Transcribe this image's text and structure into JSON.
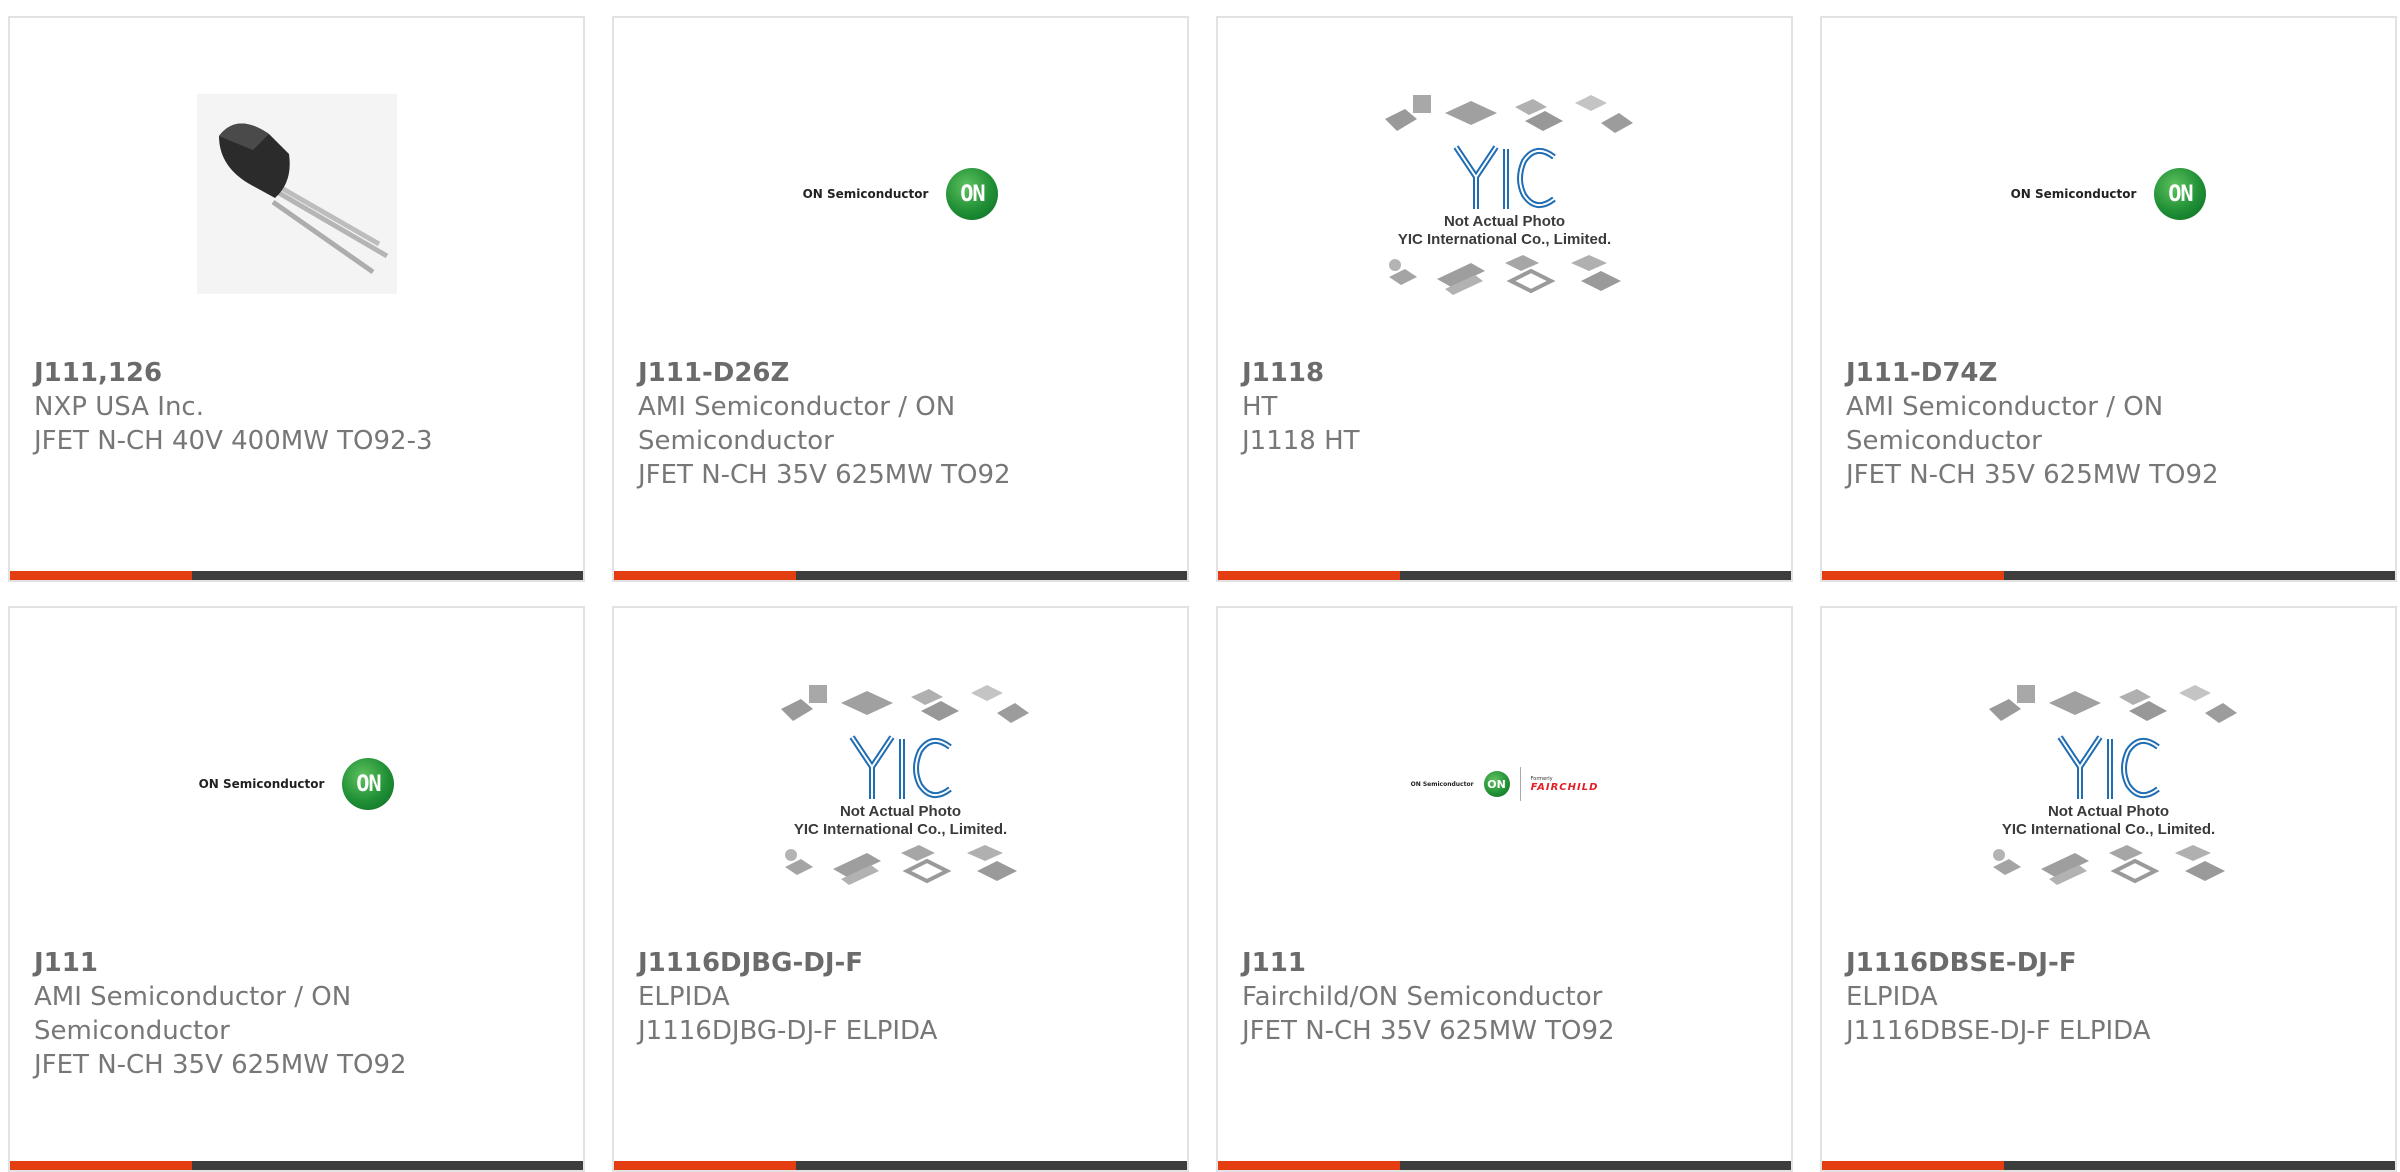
{
  "colors": {
    "accent": "#e43d12",
    "bar": "#3d3d3d",
    "border": "#e2e2e2",
    "text": "#777777"
  },
  "yic_caption": {
    "line1": "Not Actual Photo",
    "line2": "YIC International Co., Limited."
  },
  "logos": {
    "on_word": "ON Semiconductor",
    "on_mark": "ON",
    "fairchild_formerly": "Formerly",
    "fairchild_name": "FAIRCHILD"
  },
  "products": [
    {
      "part": "J111,126",
      "manufacturer": "NXP USA Inc.",
      "description": "JFET N-CH 40V 400MW TO92-3",
      "image": "transistor-photo"
    },
    {
      "part": "J111-D26Z",
      "manufacturer": "AMI Semiconductor / ON Semiconductor",
      "description": "JFET N-CH 35V 625MW TO92",
      "image": "on-semiconductor-logo"
    },
    {
      "part": "J1118",
      "manufacturer": "HT",
      "description": "J1118 HT",
      "image": "yic-placeholder"
    },
    {
      "part": "J111-D74Z",
      "manufacturer": "AMI Semiconductor / ON Semiconductor",
      "description": "JFET N-CH 35V 625MW TO92",
      "image": "on-semiconductor-logo"
    },
    {
      "part": "J111",
      "manufacturer": "AMI Semiconductor / ON Semiconductor",
      "description": "JFET N-CH 35V 625MW TO92",
      "image": "on-semiconductor-logo"
    },
    {
      "part": "J1116DJBG-DJ-F",
      "manufacturer": "ELPIDA",
      "description": "J1116DJBG-DJ-F ELPIDA",
      "image": "yic-placeholder"
    },
    {
      "part": "J111",
      "manufacturer": "Fairchild/ON Semiconductor",
      "description": "JFET N-CH 35V 625MW TO92",
      "image": "on-fairchild-logo"
    },
    {
      "part": "J1116DBSE-DJ-F",
      "manufacturer": "ELPIDA",
      "description": "J1116DBSE-DJ-F ELPIDA",
      "image": "yic-placeholder"
    }
  ]
}
